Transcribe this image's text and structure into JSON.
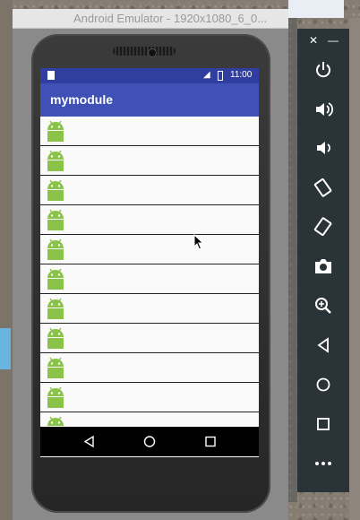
{
  "emulator": {
    "title": "Android Emulator - 1920x1080_6_0..."
  },
  "status_bar": {
    "time": "11:00",
    "signal_icon": "signal-4g-icon",
    "battery_icon": "battery-icon",
    "sd_icon": "sd-card-icon"
  },
  "app": {
    "title": "mymodule",
    "accent": "#3f51b5",
    "status_color": "#303f9f"
  },
  "list": {
    "item_icon": "android-robot-icon",
    "item_count": 11
  },
  "nav_bar": {
    "buttons": [
      "back-icon",
      "home-icon",
      "recents-icon"
    ]
  },
  "side_panel": {
    "close_label": "✕",
    "minimize_label": "—",
    "buttons": [
      "power-icon",
      "volume-up-icon",
      "volume-down-icon",
      "rotate-left-icon",
      "rotate-right-icon",
      "camera-icon",
      "zoom-icon",
      "back-icon",
      "home-icon",
      "overview-icon",
      "more-icon"
    ]
  }
}
